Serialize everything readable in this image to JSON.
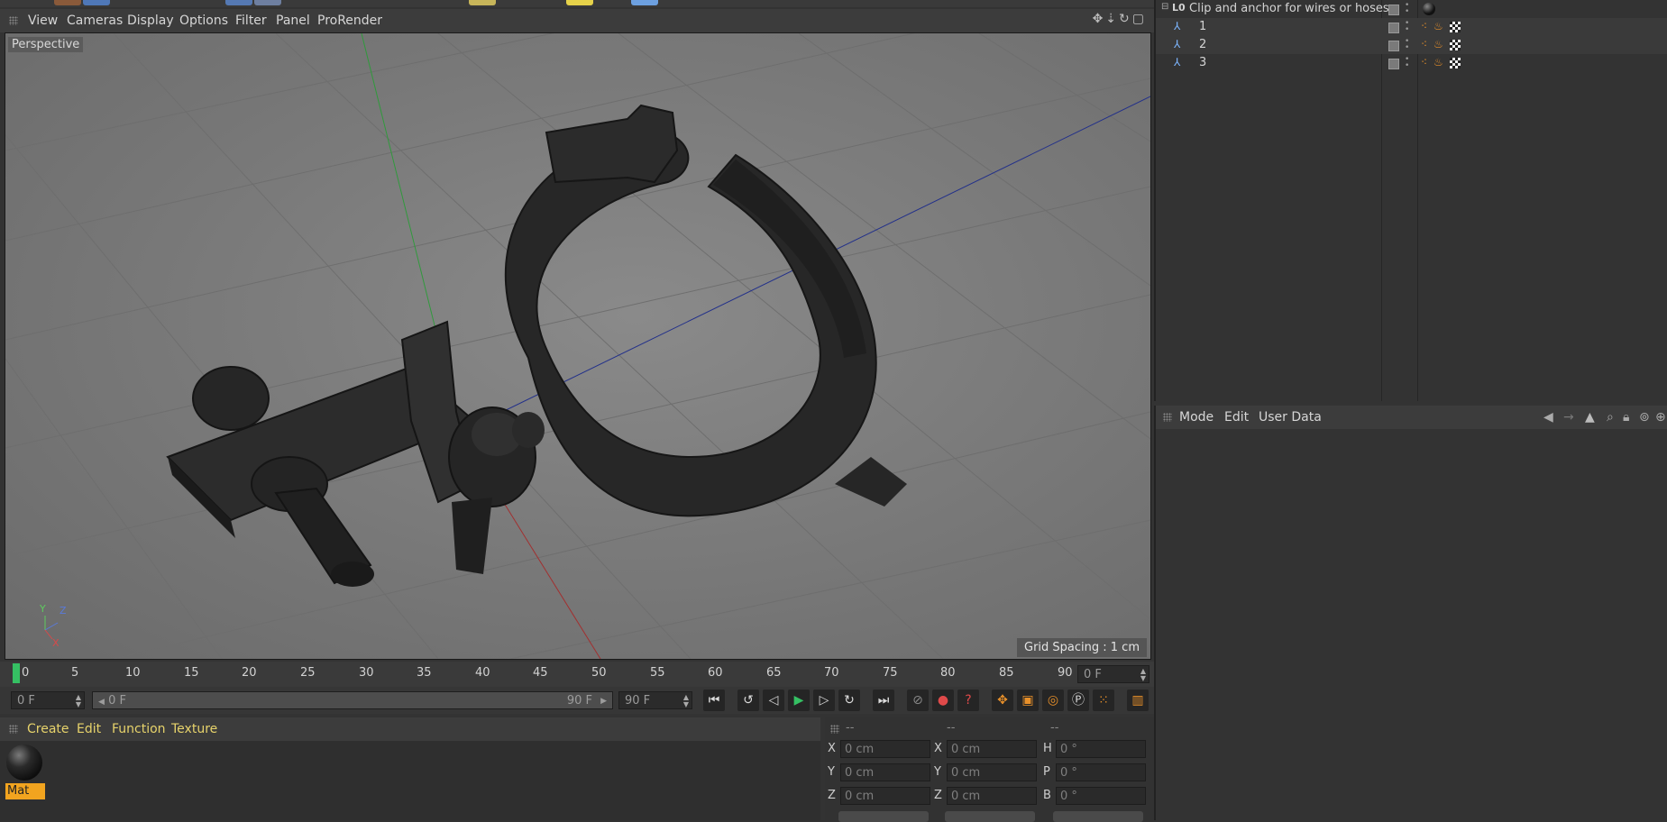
{
  "viewport": {
    "menu": [
      "View",
      "Cameras",
      "Display",
      "Options",
      "Filter",
      "Panel",
      "ProRender"
    ],
    "camera_label": "Perspective",
    "grid_spacing": "Grid Spacing : 1 cm",
    "axis_labels": {
      "y": "Y",
      "z": "Z",
      "x": "X"
    }
  },
  "timeline": {
    "ticks": [
      "0",
      "5",
      "10",
      "15",
      "20",
      "25",
      "30",
      "35",
      "40",
      "45",
      "50",
      "55",
      "60",
      "65",
      "70",
      "75",
      "80",
      "85",
      "90"
    ],
    "current_frame": "0 F",
    "start_field": "0 F",
    "range_start": "0 F",
    "range_end": "90 F",
    "end_field": "90 F"
  },
  "materials": {
    "menu": [
      "Create",
      "Edit",
      "Function",
      "Texture"
    ],
    "items": [
      {
        "name": "Mat"
      }
    ]
  },
  "coordinates": {
    "headers": [
      "--",
      "--",
      "--"
    ],
    "rows": [
      {
        "l1": "X",
        "v1": "0 cm",
        "l2": "X",
        "v2": "0 cm",
        "l3": "H",
        "v3": "0 °"
      },
      {
        "l1": "Y",
        "v1": "0 cm",
        "l2": "Y",
        "v2": "0 cm",
        "l3": "P",
        "v3": "0 °"
      },
      {
        "l1": "Z",
        "v1": "0 cm",
        "l2": "Z",
        "v2": "0 cm",
        "l3": "B",
        "v3": "0 °"
      }
    ]
  },
  "objects": {
    "root": {
      "prefix": "L0",
      "name": "Clip and anchor for wires or hoses"
    },
    "children": [
      "1",
      "2",
      "3"
    ]
  },
  "attributes": {
    "menu": [
      "Mode",
      "Edit",
      "User Data"
    ]
  },
  "colors": {
    "accent_orange": "#f2a41f",
    "playhead_green": "#35c063",
    "menu_yellow": "#e7d36b"
  }
}
